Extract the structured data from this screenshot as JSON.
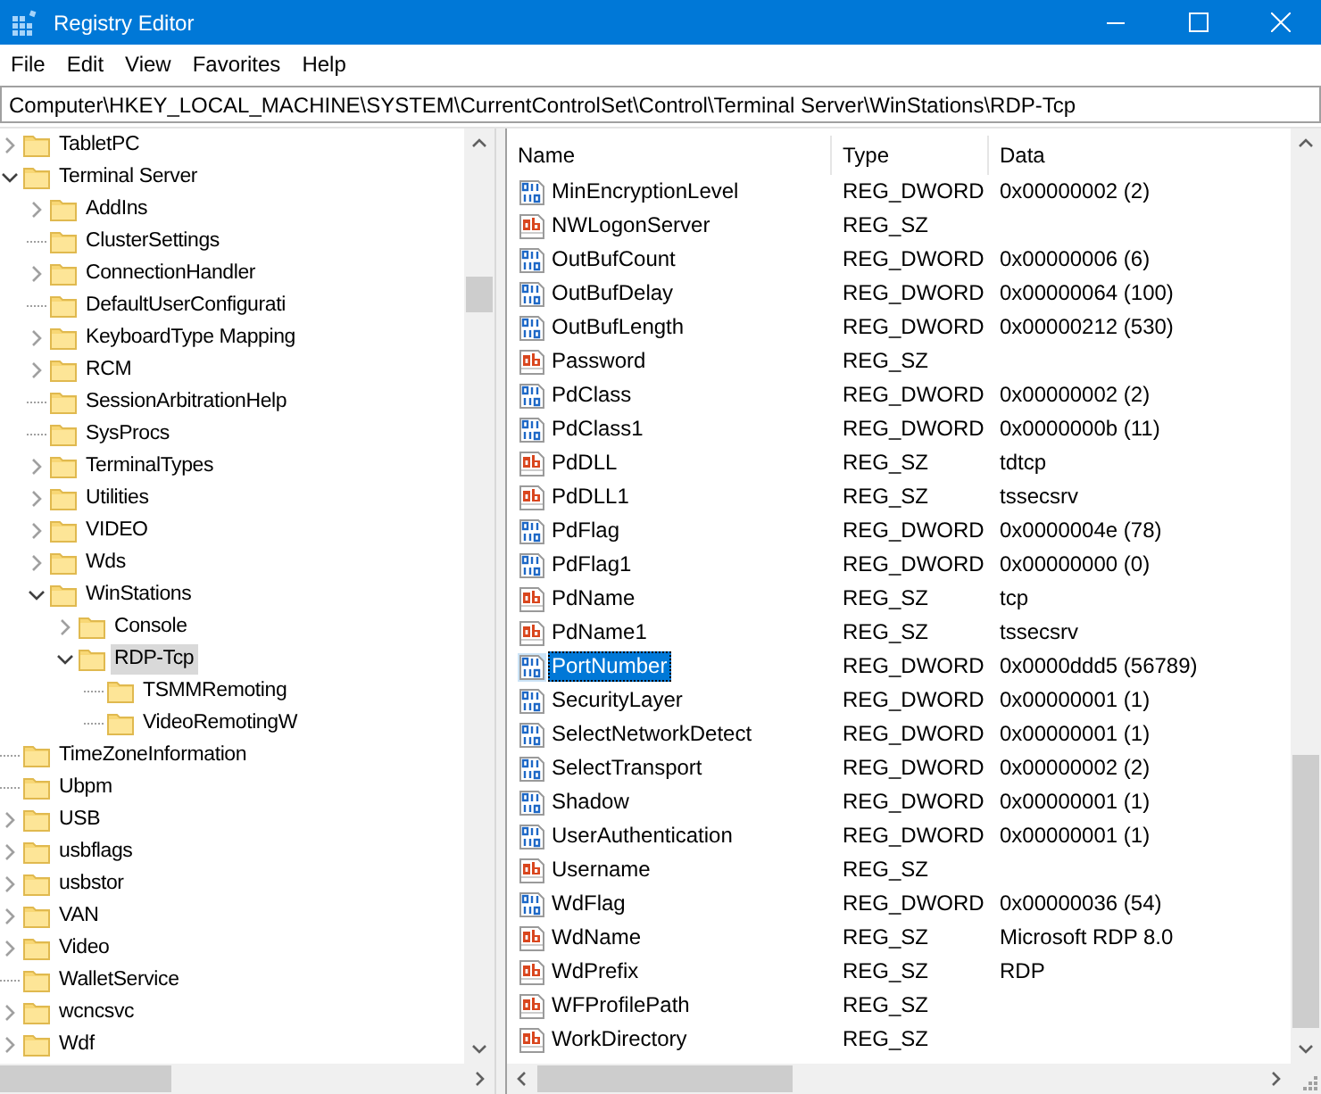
{
  "window": {
    "title": "Registry Editor"
  },
  "menu": [
    "File",
    "Edit",
    "View",
    "Favorites",
    "Help"
  ],
  "address": {
    "value": "Computer\\HKEY_LOCAL_MACHINE\\SYSTEM\\CurrentControlSet\\Control\\Terminal Server\\WinStations\\RDP-Tcp"
  },
  "tree": [
    {
      "label": "TabletPC",
      "kind": "collapsed",
      "selected": false
    },
    {
      "label": "Terminal Server",
      "kind": "expanded",
      "selected": false,
      "children": [
        {
          "label": "AddIns",
          "kind": "collapsed",
          "selected": false
        },
        {
          "label": "ClusterSettings",
          "kind": "leaf",
          "selected": false
        },
        {
          "label": "ConnectionHandler",
          "kind": "collapsed",
          "selected": false
        },
        {
          "label": "DefaultUserConfigurati",
          "kind": "leaf",
          "selected": false
        },
        {
          "label": "KeyboardType Mapping",
          "kind": "collapsed",
          "selected": false
        },
        {
          "label": "RCM",
          "kind": "collapsed",
          "selected": false
        },
        {
          "label": "SessionArbitrationHelp",
          "kind": "leaf",
          "selected": false
        },
        {
          "label": "SysProcs",
          "kind": "leaf",
          "selected": false
        },
        {
          "label": "TerminalTypes",
          "kind": "collapsed",
          "selected": false
        },
        {
          "label": "Utilities",
          "kind": "collapsed",
          "selected": false
        },
        {
          "label": "VIDEO",
          "kind": "collapsed",
          "selected": false
        },
        {
          "label": "Wds",
          "kind": "collapsed",
          "selected": false
        },
        {
          "label": "WinStations",
          "kind": "expanded",
          "selected": false,
          "children": [
            {
              "label": "Console",
              "kind": "collapsed",
              "selected": false
            },
            {
              "label": "RDP-Tcp",
              "kind": "expanded",
              "selected": true,
              "children": [
                {
                  "label": "TSMMRemoting",
                  "kind": "leaf",
                  "selected": false
                },
                {
                  "label": "VideoRemotingW",
                  "kind": "leaf",
                  "selected": false
                }
              ]
            }
          ]
        }
      ]
    },
    {
      "label": "TimeZoneInformation",
      "kind": "leaf",
      "selected": false
    },
    {
      "label": "Ubpm",
      "kind": "leaf",
      "selected": false
    },
    {
      "label": "USB",
      "kind": "collapsed",
      "selected": false
    },
    {
      "label": "usbflags",
      "kind": "collapsed",
      "selected": false
    },
    {
      "label": "usbstor",
      "kind": "collapsed",
      "selected": false
    },
    {
      "label": "VAN",
      "kind": "collapsed",
      "selected": false
    },
    {
      "label": "Video",
      "kind": "collapsed",
      "selected": false
    },
    {
      "label": "WalletService",
      "kind": "leaf",
      "selected": false
    },
    {
      "label": "wcncsvc",
      "kind": "collapsed",
      "selected": false
    },
    {
      "label": "Wdf",
      "kind": "collapsed",
      "selected": false
    }
  ],
  "table": {
    "columns": [
      "Name",
      "Type",
      "Data"
    ],
    "rows": [
      {
        "kind": "number",
        "name": "MinEncryptionLevel",
        "type": "REG_DWORD",
        "data": "0x00000002 (2)",
        "selected": false
      },
      {
        "kind": "string",
        "name": "NWLogonServer",
        "type": "REG_SZ",
        "selected": false
      },
      {
        "kind": "number",
        "name": "OutBufCount",
        "type": "REG_DWORD",
        "data": "0x00000006 (6)",
        "selected": false
      },
      {
        "kind": "number",
        "name": "OutBufDelay",
        "type": "REG_DWORD",
        "data": "0x00000064 (100)",
        "selected": false
      },
      {
        "kind": "number",
        "name": "OutBufLength",
        "type": "REG_DWORD",
        "data": "0x00000212 (530)",
        "selected": false
      },
      {
        "kind": "string",
        "name": "Password",
        "type": "REG_SZ",
        "selected": false
      },
      {
        "kind": "number",
        "name": "PdClass",
        "type": "REG_DWORD",
        "data": "0x00000002 (2)",
        "selected": false
      },
      {
        "kind": "number",
        "name": "PdClass1",
        "type": "REG_DWORD",
        "data": "0x0000000b (11)",
        "selected": false
      },
      {
        "kind": "string",
        "name": "PdDLL",
        "type": "REG_SZ",
        "data": "tdtcp",
        "selected": false
      },
      {
        "kind": "string",
        "name": "PdDLL1",
        "type": "REG_SZ",
        "data": "tssecsrv",
        "selected": false
      },
      {
        "kind": "number",
        "name": "PdFlag",
        "type": "REG_DWORD",
        "data": "0x0000004e (78)",
        "selected": false
      },
      {
        "kind": "number",
        "name": "PdFlag1",
        "type": "REG_DWORD",
        "data": "0x00000000 (0)",
        "selected": false
      },
      {
        "kind": "string",
        "name": "PdName",
        "type": "REG_SZ",
        "data": "tcp",
        "selected": false
      },
      {
        "kind": "string",
        "name": "PdName1",
        "type": "REG_SZ",
        "data": "tssecsrv",
        "selected": false
      },
      {
        "kind": "number",
        "name": "PortNumber",
        "type": "REG_DWORD",
        "data": "0x0000ddd5 (56789)",
        "selected": true
      },
      {
        "kind": "number",
        "name": "SecurityLayer",
        "type": "REG_DWORD",
        "data": "0x00000001 (1)",
        "selected": false
      },
      {
        "kind": "number",
        "name": "SelectNetworkDetect",
        "type": "REG_DWORD",
        "data": "0x00000001 (1)",
        "selected": false
      },
      {
        "kind": "number",
        "name": "SelectTransport",
        "type": "REG_DWORD",
        "data": "0x00000002 (2)",
        "selected": false
      },
      {
        "kind": "number",
        "name": "Shadow",
        "type": "REG_DWORD",
        "data": "0x00000001 (1)",
        "selected": false
      },
      {
        "kind": "number",
        "name": "UserAuthentication",
        "type": "REG_DWORD",
        "data": "0x00000001 (1)",
        "selected": false
      },
      {
        "kind": "string",
        "name": "Username",
        "type": "REG_SZ",
        "selected": false
      },
      {
        "kind": "number",
        "name": "WdFlag",
        "type": "REG_DWORD",
        "data": "0x00000036 (54)",
        "selected": false
      },
      {
        "kind": "string",
        "name": "WdName",
        "type": "REG_SZ",
        "data": "Microsoft RDP 8.0",
        "selected": false
      },
      {
        "kind": "string",
        "name": "WdPrefix",
        "type": "REG_SZ",
        "data": "RDP",
        "selected": false
      },
      {
        "kind": "string",
        "name": "WFProfilePath",
        "type": "REG_SZ",
        "selected": false
      },
      {
        "kind": "string",
        "name": "WorkDirectory",
        "type": "REG_SZ",
        "selected": false
      }
    ]
  }
}
